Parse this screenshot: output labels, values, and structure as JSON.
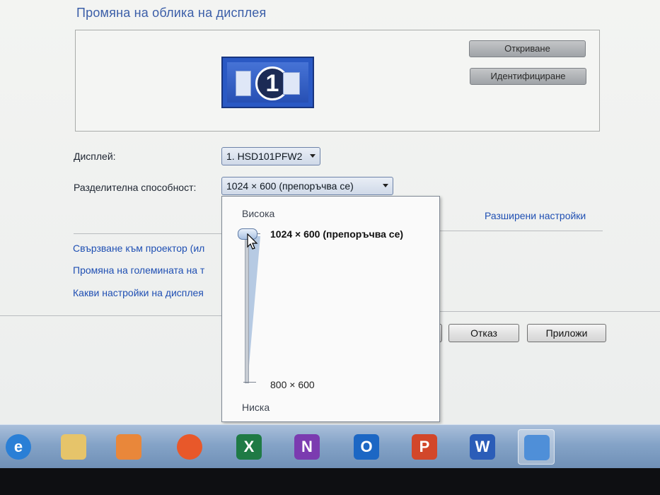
{
  "window": {
    "title": "Промяна на облика на дисплея",
    "detect_button": "Откриване",
    "identify_button": "Идентифициране",
    "monitor_number": "1",
    "display_label": "Дисплей:",
    "display_value": "1. HSD101PFW2",
    "resolution_label": "Разделителна способност:",
    "resolution_value": "1024 × 600 (препоръчва се)",
    "advanced_link": "Разширени настройки",
    "links": [
      "Свързване към проектор (ил",
      "Промяна на големината на т",
      "Какви настройки на дисплея"
    ],
    "cancel_button": "Отказ",
    "apply_button": "Приложи"
  },
  "resolution_dropdown": {
    "high_label": "Висока",
    "low_label": "Ниска",
    "top_option": "1024 × 600 (препоръчва се)",
    "bottom_option": "800 × 600",
    "selected_level": 1.0
  },
  "taskbar": {
    "items": [
      {
        "icon": "internet-explorer-icon",
        "letter": "e",
        "color": "#2a7fd6"
      },
      {
        "icon": "file-explorer-icon",
        "letter": "",
        "color": "#e6c46a"
      },
      {
        "icon": "media-player-icon",
        "letter": "",
        "color": "#e9873a"
      },
      {
        "icon": "firefox-icon",
        "letter": "",
        "color": "#e8582a"
      },
      {
        "icon": "excel-icon",
        "letter": "X",
        "color": "#1f7a45"
      },
      {
        "icon": "onenote-icon",
        "letter": "N",
        "color": "#7b3bb0"
      },
      {
        "icon": "outlook-icon",
        "letter": "O",
        "color": "#1c67c4"
      },
      {
        "icon": "powerpoint-icon",
        "letter": "P",
        "color": "#d2472a"
      },
      {
        "icon": "word-icon",
        "letter": "W",
        "color": "#2b5db8"
      },
      {
        "icon": "control-panel-icon",
        "letter": "",
        "color": "#4f8fd8"
      }
    ]
  }
}
